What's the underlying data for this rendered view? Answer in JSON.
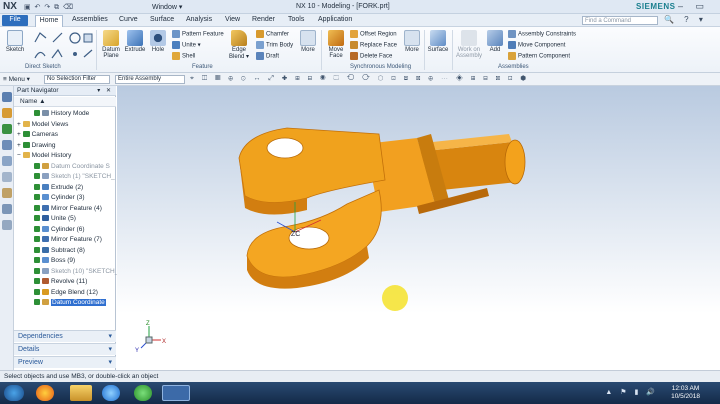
{
  "titlebar": {
    "app": "NX",
    "quick_access": "▣ ↶ ↷ ⧉ ⌫",
    "window_menu": "Window ▾",
    "title": "NX 10 - Modeling - [FORK.prt]",
    "brand": "SIEMENS",
    "controls": "– ▭ ✕"
  },
  "menu": {
    "tabs": [
      "File",
      "Home",
      "Assemblies",
      "Curve",
      "Surface",
      "Analysis",
      "View",
      "Render",
      "Tools",
      "Application"
    ],
    "find_placeholder": "Find a Command",
    "right_icons": "🔍 ? ▾"
  },
  "ribbon": {
    "groups": {
      "direct_sketch": "Direct Sketch",
      "feature": "Feature",
      "synchronous": "Synchronous Modeling",
      "assemblies": "Assemblies"
    },
    "sketch": "Sketch",
    "datum_plane": "Datum Plane",
    "extrude": "Extrude",
    "hole": "Hole",
    "pattern_feature": "Pattern Feature",
    "unite": "Unite ▾",
    "shell": "Shell",
    "edge_blend": "Edge Blend ▾",
    "chamfer": "Chamfer",
    "trim_body": "Trim Body",
    "draft": "Draft",
    "more": "More",
    "move_face": "Move Face",
    "offset_region": "Offset Region",
    "replace_face": "Replace Face",
    "delete_face": "Delete Face",
    "surface": "Surface",
    "work_on_assembly": "Work on Assembly",
    "add": "Add",
    "assembly_constraints": "Assembly Constraints",
    "move_component": "Move Component",
    "pattern_component": "Pattern Component"
  },
  "toolbar": {
    "menu": "≡ Menu ▾",
    "selection_filter": "No Selection Filter",
    "scope": "Entire Assembly",
    "icons": "⌖ ◫ ▦ ⊕ ⊙ ↔ ⤢ ✚ ⊞ ⊟ ◉ ⬚ ⟲ ⟳ ⬡ ⊡ ⧈ ⊠ ⊕ ⋯ ◈ ⊞ ⊟ ⊠ ⊡ ⬢"
  },
  "navigator": {
    "title": "Part Navigator",
    "header_controls": "▾ ✕",
    "column": "Name ▲",
    "rows": [
      {
        "label": "History Mode",
        "level": 1,
        "icon": "clock"
      },
      {
        "label": "Model Views",
        "level": 0,
        "icon": "folder",
        "expander": "+"
      },
      {
        "label": "Cameras",
        "level": 0,
        "icon": "check",
        "expander": "+"
      },
      {
        "label": "Drawing",
        "level": 0,
        "icon": "check",
        "expander": "+"
      },
      {
        "label": "Model History",
        "level": 0,
        "icon": "folder",
        "expander": "−"
      },
      {
        "label": "Datum Coordinate S",
        "level": 1,
        "icon": "datum",
        "gray": true
      },
      {
        "label": "Sketch (1) \"SKETCH_",
        "level": 1,
        "icon": "sketch",
        "gray": true
      },
      {
        "label": "Extrude (2)",
        "level": 1,
        "icon": "extrude"
      },
      {
        "label": "Cylinder (3)",
        "level": 1,
        "icon": "cyl"
      },
      {
        "label": "Mirror Feature (4)",
        "level": 1,
        "icon": "mirror"
      },
      {
        "label": "Unite (5)",
        "level": 1,
        "icon": "unite"
      },
      {
        "label": "Cylinder (6)",
        "level": 1,
        "icon": "cyl"
      },
      {
        "label": "Mirror Feature (7)",
        "level": 1,
        "icon": "mirror"
      },
      {
        "label": "Subtract (8)",
        "level": 1,
        "icon": "subtract"
      },
      {
        "label": "Boss (9)",
        "level": 1,
        "icon": "cyl"
      },
      {
        "label": "Sketch (10) \"SKETCH_",
        "level": 1,
        "icon": "sketch",
        "gray": true
      },
      {
        "label": "Revolve (11)",
        "level": 1,
        "icon": "revolve"
      },
      {
        "label": "Edge Blend (12)",
        "level": 1,
        "icon": "blend"
      },
      {
        "label": "Datum Coordinate",
        "level": 1,
        "icon": "datum",
        "selected": true
      }
    ],
    "panels": [
      "Dependencies",
      "Details",
      "Preview"
    ]
  },
  "viewport": {
    "csys_label": "ZC",
    "axis_x": "X",
    "axis_y": "Y",
    "axis_z": "Z"
  },
  "status": {
    "text": "Select objects and use MB3, or double-click an object"
  },
  "taskbar": {
    "clock_time": "12:03 AM",
    "clock_date": "10/5/2018",
    "tray": "▲ ⚑ ▮ 🔊"
  },
  "colors": {
    "part": "#f3a21c",
    "accent": "#2d6ebd"
  }
}
